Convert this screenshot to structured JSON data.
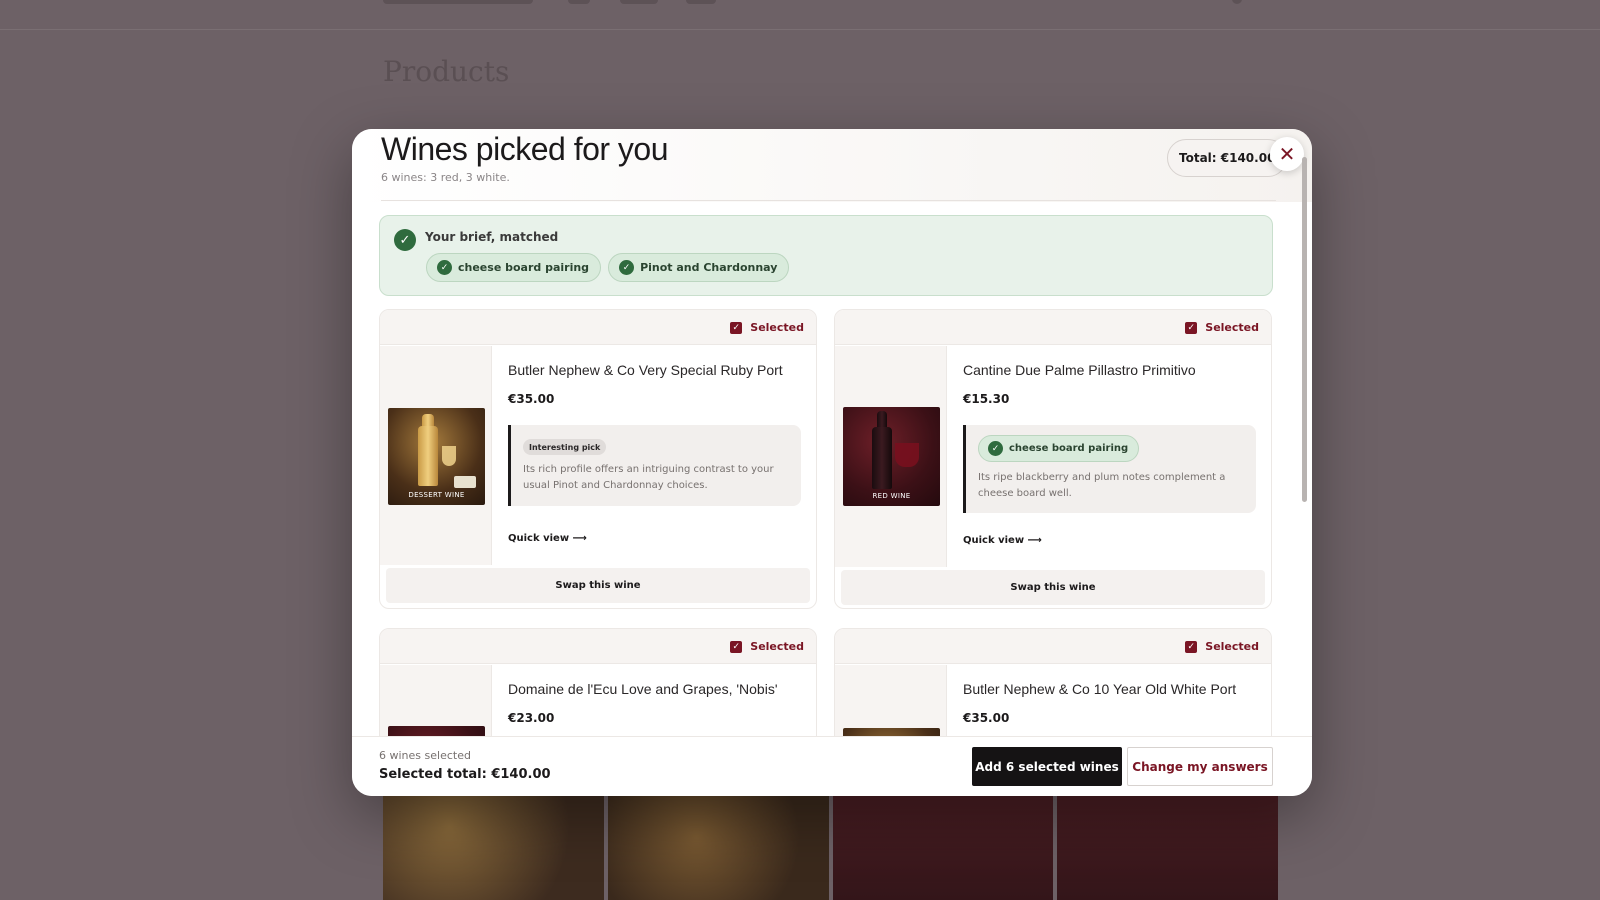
{
  "background": {
    "heading": "Products"
  },
  "modal": {
    "title": "Wines picked for you",
    "subtitle": "6 wines: 3 red, 3 white.",
    "total_pill": "Total: €140.00",
    "close_icon": "close-icon"
  },
  "brief": {
    "title": "Your brief, matched",
    "chips": [
      {
        "label": "cheese board pairing"
      },
      {
        "label": "Pinot and Chardonnay"
      }
    ]
  },
  "cards": [
    {
      "selected_label": "Selected",
      "name": "Butler Nephew & Co Very Special Ruby Port",
      "price": "€35.00",
      "image_caption": "DESSERT WINE",
      "tag": "Interesting pick",
      "note": "Its rich profile offers an intriguing contrast to your usual Pinot and Chardonnay choices.",
      "quick_view": "Quick view ⟶",
      "swap": "Swap this wine"
    },
    {
      "selected_label": "Selected",
      "name": "Cantine Due Palme Pillastro Primitivo",
      "price": "€15.30",
      "image_caption": "RED WINE",
      "tag": "cheese board pairing",
      "note": "Its ripe blackberry and plum notes complement a cheese board well.",
      "quick_view": "Quick view ⟶",
      "swap": "Swap this wine"
    },
    {
      "selected_label": "Selected",
      "name": "Domaine de l'Ecu Love and Grapes, 'Nobis'",
      "price": "€23.00"
    },
    {
      "selected_label": "Selected",
      "name": "Butler Nephew & Co 10 Year Old White Port",
      "price": "€35.00"
    }
  ],
  "footer": {
    "count": "6 wines selected",
    "total": "Selected total: €140.00",
    "add_button": "Add 6 selected wines",
    "change_button": "Change my answers"
  },
  "colors": {
    "accent": "#7a1524",
    "success": "#2f6b3e",
    "primary_button": "#151314"
  }
}
